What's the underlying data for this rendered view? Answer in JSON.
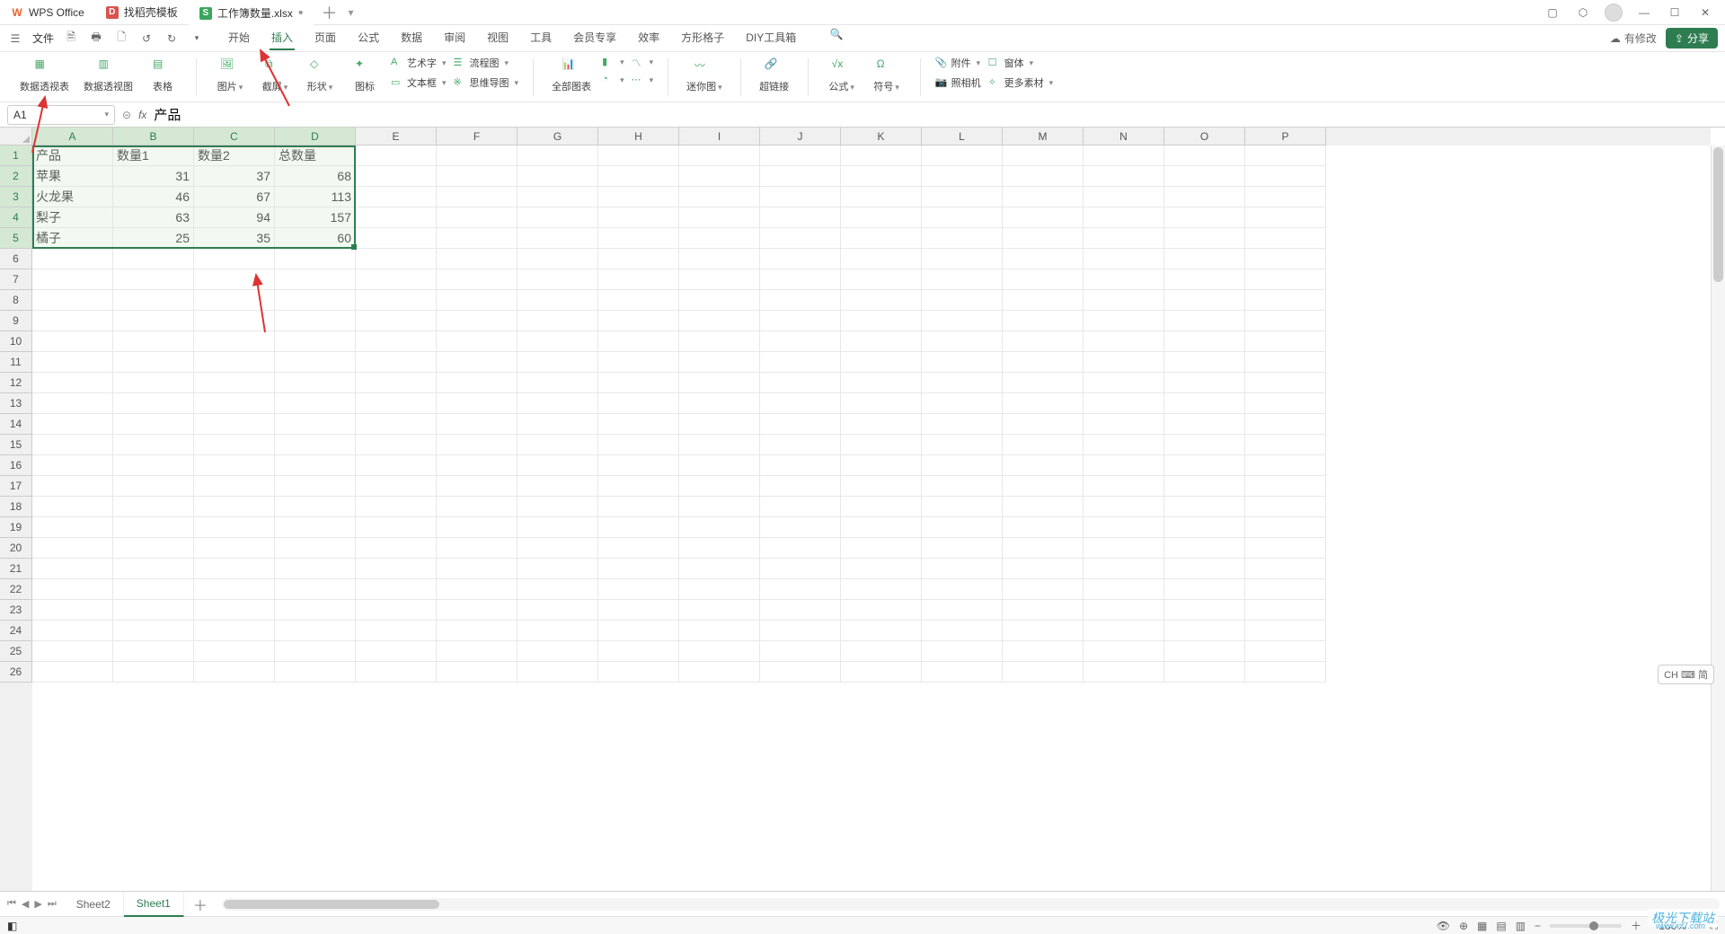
{
  "titlebar": {
    "tabs": [
      {
        "label": "WPS Office",
        "icon": "W"
      },
      {
        "label": "找稻壳模板",
        "icon": "D"
      },
      {
        "label": "工作簿数量.xlsx",
        "icon": "S",
        "modified": true
      }
    ]
  },
  "quick_access": {
    "file_label": "文件"
  },
  "menu": {
    "items": [
      "开始",
      "插入",
      "页面",
      "公式",
      "数据",
      "审阅",
      "视图",
      "工具",
      "会员专享",
      "效率",
      "方形格子",
      "DIY工具箱"
    ],
    "active": "插入",
    "cloud_status": "有修改",
    "share_label": "分享"
  },
  "ribbon": {
    "pivot_table": "数据透视表",
    "pivot_chart": "数据透视图",
    "table": "表格",
    "picture": "图片",
    "screenshot": "截屏",
    "shapes": "形状",
    "icons": "图标",
    "wordart": "艺术字",
    "textbox": "文本框",
    "flowchart": "流程图",
    "mindmap": "思维导图",
    "all_charts": "全部图表",
    "sparkline": "迷你图",
    "hyperlink": "超链接",
    "formula": "公式",
    "symbol": "符号",
    "attachment": "附件",
    "camera": "照相机",
    "form": "窗体",
    "more_material": "更多素材"
  },
  "formula_bar": {
    "name_box": "A1",
    "fx": "fx",
    "value": "产品"
  },
  "chart_data": {
    "type": "table",
    "columns": [
      "A",
      "B",
      "C",
      "D",
      "E",
      "F",
      "G",
      "H",
      "I",
      "J",
      "K",
      "L",
      "M",
      "N",
      "O",
      "P"
    ],
    "headers": [
      "产品",
      "数量1",
      "数量2",
      "总数量"
    ],
    "rows": [
      [
        "苹果",
        31,
        37,
        68
      ],
      [
        "火龙果",
        46,
        67,
        113
      ],
      [
        "梨子",
        63,
        94,
        157
      ],
      [
        "橘子",
        25,
        35,
        60
      ]
    ],
    "selected_columns": [
      "A",
      "B",
      "C",
      "D"
    ],
    "selected_rows": [
      1,
      2,
      3,
      4,
      5
    ],
    "row_count_visible": 26
  },
  "sheet_tabs": {
    "sheets": [
      "Sheet2",
      "Sheet1"
    ],
    "active": "Sheet1"
  },
  "status": {
    "zoom": "160%",
    "ime": "CH ⌨ 简"
  },
  "watermark": {
    "brand": "极光下载站",
    "url": "www.xz7.com"
  }
}
